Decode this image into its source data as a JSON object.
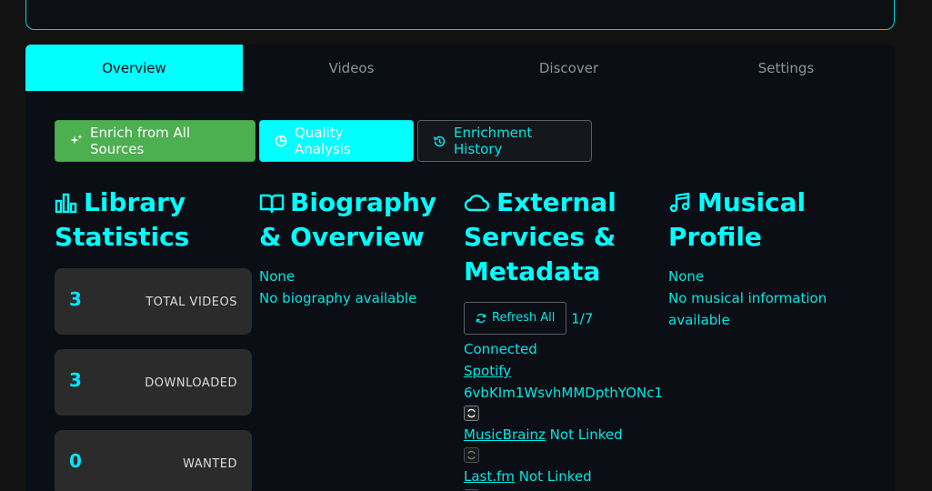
{
  "tabs": [
    "Overview",
    "Videos",
    "Discover",
    "Settings"
  ],
  "actions": {
    "enrich": "Enrich from All Sources",
    "quality": "Quality Analysis",
    "history": "Enrichment History"
  },
  "stats": {
    "title": "Library Statistics",
    "cards": [
      {
        "value": "3",
        "label": "TOTAL VIDEOS"
      },
      {
        "value": "3",
        "label": "DOWNLOADED"
      },
      {
        "value": "0",
        "label": "WANTED"
      }
    ]
  },
  "biography": {
    "title": "Biography & Overview",
    "line1": "None",
    "line2": "No biography available"
  },
  "external": {
    "title": "External Services & Metadata",
    "refresh": "Refresh All",
    "count": "1/7",
    "connected": "Connected",
    "services": [
      {
        "name": "Spotify",
        "value": "6vbKIm1WsvhMMDpthYONc1"
      },
      {
        "name": "MusicBrainz",
        "status": "Not Linked"
      },
      {
        "name": "Last.fm",
        "status": "Not Linked"
      }
    ]
  },
  "musical": {
    "title": "Musical Profile",
    "line1": "None",
    "line2": "No musical information available"
  },
  "colors": {
    "accent": "#00ffff",
    "green": "#4caf50",
    "card": "#2b2b2b",
    "panel": "#0b0e14"
  }
}
